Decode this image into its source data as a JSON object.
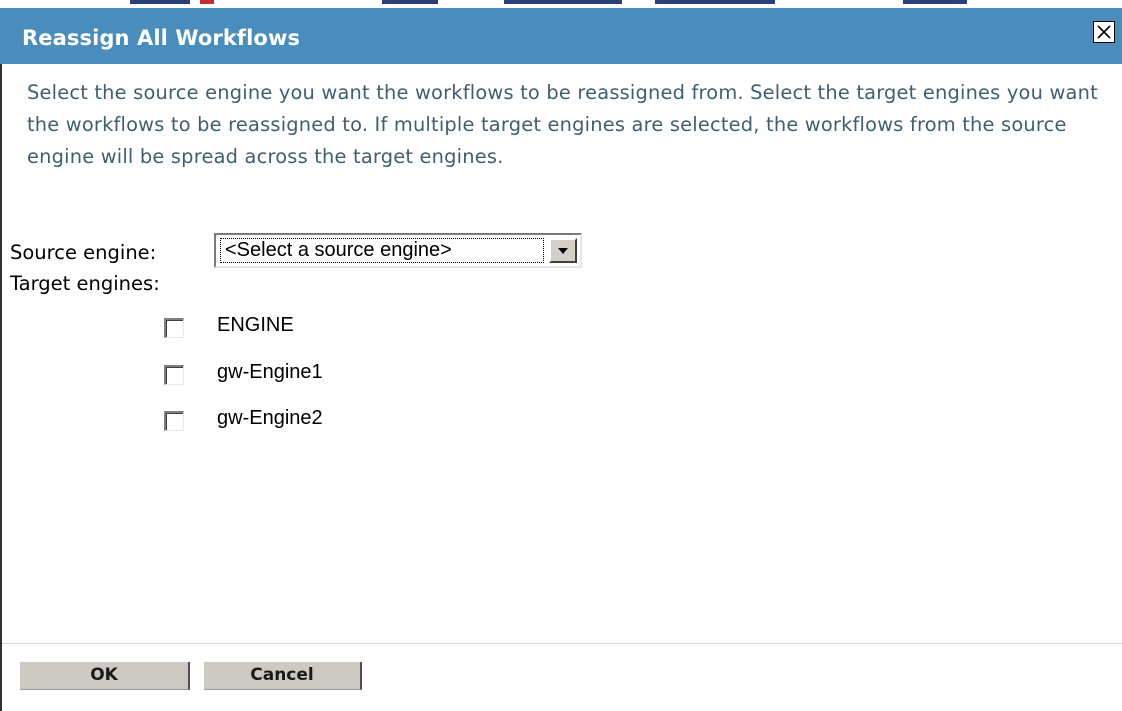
{
  "dialog": {
    "title": "Reassign All Workflows",
    "close_icon": "close-icon",
    "instructions": "Select the source engine you want the workflows to be reassigned from.  Select the target engines you want the workflows to be reassigned to.  If multiple target engines are selected, the workflows from the source engine will be spread across the target engines."
  },
  "form": {
    "source_label": "Source engine:",
    "source_selected": "<Select a source engine>",
    "target_label": "Target engines:",
    "engines": [
      {
        "label": "ENGINE",
        "checked": false
      },
      {
        "label": "gw-Engine1",
        "checked": false
      },
      {
        "label": "gw-Engine2",
        "checked": false
      }
    ]
  },
  "buttons": {
    "ok_label": "OK",
    "cancel_label": "Cancel"
  },
  "colors": {
    "titlebar": "#4a8dbd",
    "instruction_text": "#3f5f70",
    "button_face": "#cdcac3"
  }
}
